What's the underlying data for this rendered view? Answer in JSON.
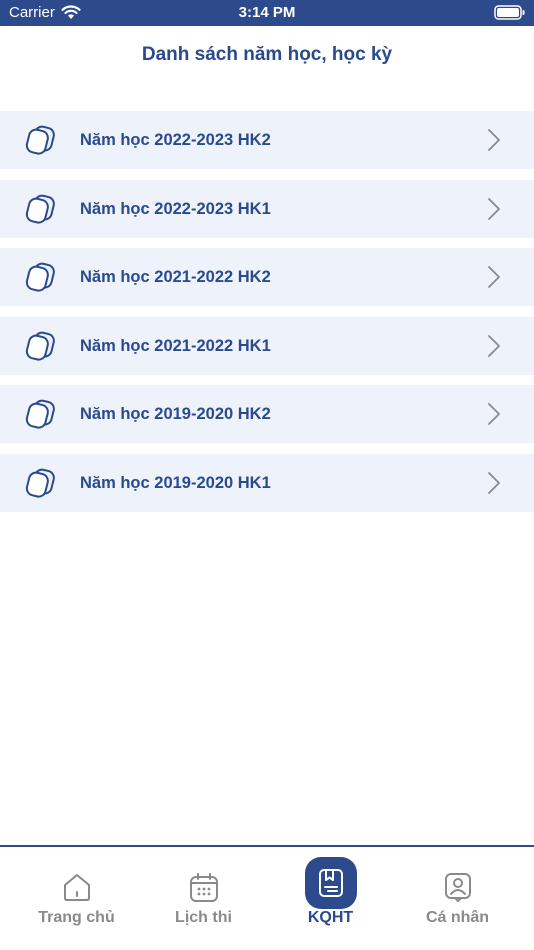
{
  "status_bar": {
    "carrier": "Carrier",
    "time": "3:14 PM"
  },
  "header": {
    "title": "Danh sách năm học, học kỳ"
  },
  "semesters": [
    {
      "label": "Năm học 2022-2023 HK2"
    },
    {
      "label": "Năm học 2022-2023 HK1"
    },
    {
      "label": "Năm học 2021-2022 HK2"
    },
    {
      "label": "Năm học 2021-2022 HK1"
    },
    {
      "label": "Năm học 2019-2020 HK2"
    },
    {
      "label": "Năm học 2019-2020 HK1"
    }
  ],
  "tab_bar": {
    "tabs": [
      {
        "label": "Trang chủ",
        "icon": "home-icon",
        "active": false
      },
      {
        "label": "Lịch thi",
        "icon": "calendar-icon",
        "active": false
      },
      {
        "label": "KQHT",
        "icon": "results-book-icon",
        "active": true
      },
      {
        "label": "Cá nhân",
        "icon": "profile-icon",
        "active": false
      }
    ]
  },
  "colors": {
    "primary": "#2c4a8c",
    "row_background": "#edf2fb",
    "inactive_tab": "#8a8a8a"
  }
}
